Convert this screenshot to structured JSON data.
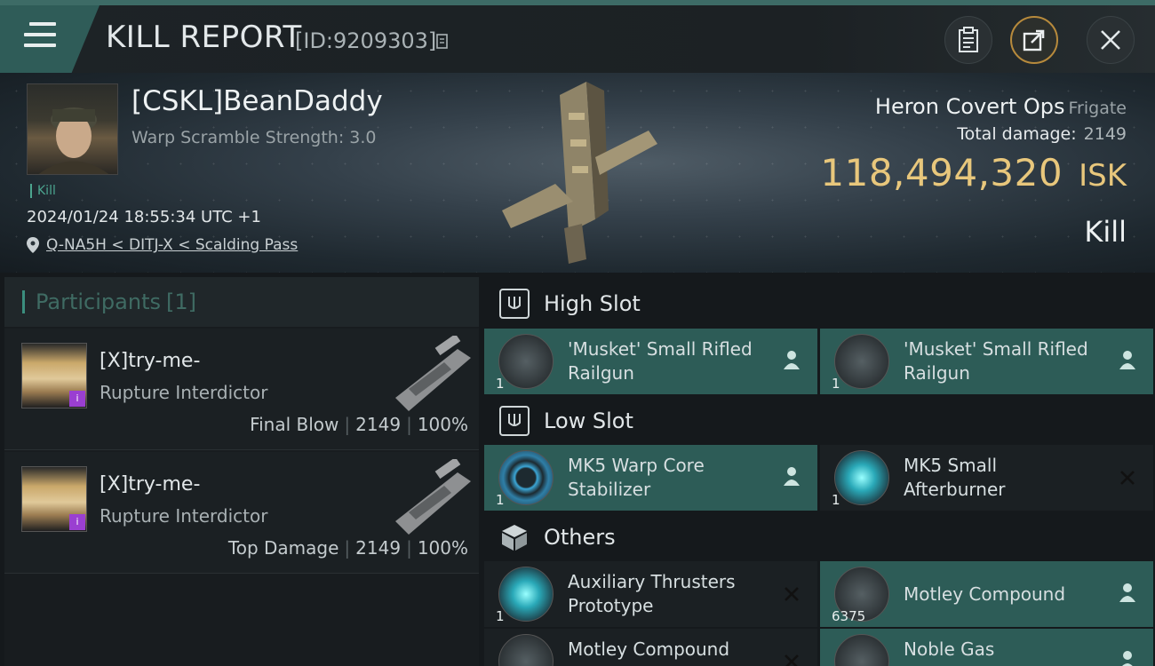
{
  "header": {
    "menu_icon": "menu-icon",
    "title": "KILL REPORT",
    "report_id": "[ID:9209303]",
    "buttons": [
      "clipboard-icon",
      "share-icon",
      "close-icon"
    ]
  },
  "victim": {
    "name": "[CSKL]BeanDaddy",
    "scramble": "Warp Scramble Strength: 3.0",
    "kill_tag": "Kill",
    "datetime": "2024/01/24 18:55:34 UTC +1",
    "location": "Q-NA5H < DITJ-X < Scalding Pass"
  },
  "ship": {
    "name": "Heron Covert Ops",
    "class": "Frigate",
    "total_damage_label": "Total damage:",
    "total_damage": "2149",
    "isk_value": "118,494,320",
    "isk_unit": "ISK",
    "result": "Kill"
  },
  "participants": {
    "title": "Participants",
    "count": "[1]",
    "rows": [
      {
        "name": "[X]try-me-",
        "ship": "Rupture Interdictor",
        "role": "Final Blow",
        "damage": "2149",
        "percent": "100%"
      },
      {
        "name": "[X]try-me-",
        "ship": "Rupture Interdictor",
        "role": "Top Damage",
        "damage": "2149",
        "percent": "100%"
      }
    ]
  },
  "fitting": {
    "high": {
      "label": "High Slot",
      "items": [
        {
          "name": "'Musket' Small Rifled Railgun",
          "qty": "1"
        },
        {
          "name": "'Musket' Small Rifled Railgun",
          "qty": "1"
        }
      ]
    },
    "low": {
      "label": "Low Slot",
      "items": [
        {
          "name": "MK5 Warp Core Stabilizer",
          "qty": "1"
        },
        {
          "name": "MK5 Small Afterburner",
          "qty": "1"
        }
      ]
    },
    "others": {
      "label": "Others",
      "items": [
        {
          "name": "Auxiliary Thrusters Prototype",
          "qty": "1"
        },
        {
          "name": "Motley Compound",
          "qty": "6375"
        },
        {
          "name": "Motley Compound",
          "qty": ""
        },
        {
          "name": "Noble Gas",
          "qty": ""
        }
      ]
    }
  },
  "colors": {
    "accent": "#2d5c57",
    "isk": "#e8c77c",
    "destroyed": "#1b2023"
  }
}
